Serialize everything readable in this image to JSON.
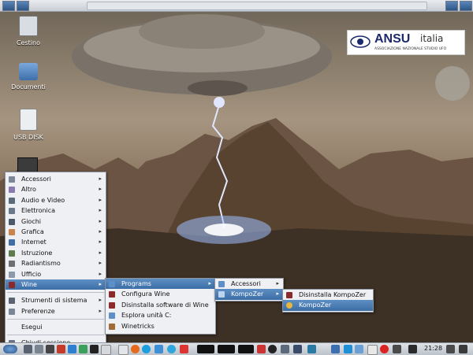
{
  "logo": {
    "brand": "ANSU",
    "suffix": "italia",
    "tagline": "ASSOCIAZIONE NAZIONALE STUDIO UFO"
  },
  "desktop_icons": [
    {
      "label": "Cestino",
      "icon": "trash-icon"
    },
    {
      "label": "Documenti",
      "icon": "folder-icon"
    },
    {
      "label": "USB DISK",
      "icon": "usb-drive-icon"
    }
  ],
  "main_menu": {
    "items": [
      {
        "label": "Accessori",
        "icon": "accessories-icon",
        "submenu": true
      },
      {
        "label": "Altro",
        "icon": "other-icon",
        "submenu": true
      },
      {
        "label": "Audio e Video",
        "icon": "multimedia-icon",
        "submenu": true
      },
      {
        "label": "Elettronica",
        "icon": "electronics-icon",
        "submenu": true
      },
      {
        "label": "Giochi",
        "icon": "games-icon",
        "submenu": true
      },
      {
        "label": "Grafica",
        "icon": "graphics-icon",
        "submenu": true
      },
      {
        "label": "Internet",
        "icon": "internet-icon",
        "submenu": true
      },
      {
        "label": "Istruzione",
        "icon": "education-icon",
        "submenu": true
      },
      {
        "label": "Radiantismo",
        "icon": "ham-radio-icon",
        "submenu": true
      },
      {
        "label": "Ufficio",
        "icon": "office-icon",
        "submenu": true
      },
      {
        "label": "Wine",
        "icon": "wine-icon",
        "submenu": true,
        "highlighted": true
      }
    ],
    "system_items": [
      {
        "label": "Strumenti di sistema",
        "icon": "system-tools-icon",
        "submenu": true
      },
      {
        "label": "Preferenze",
        "icon": "preferences-icon",
        "submenu": true
      }
    ],
    "run_label": "Esegui",
    "logout_label": "Chiudi sessione"
  },
  "wine_menu": {
    "items": [
      {
        "label": "Programs",
        "icon": "folder-icon",
        "submenu": true,
        "highlighted": true
      },
      {
        "label": "Configura Wine",
        "icon": "wine-icon"
      },
      {
        "label": "Disinstalla software di Wine",
        "icon": "wine-icon"
      },
      {
        "label": "Esplora unità C:",
        "icon": "folder-icon"
      },
      {
        "label": "Winetricks",
        "icon": "winetricks-icon"
      }
    ]
  },
  "programs_menu": {
    "items": [
      {
        "label": "Accessori",
        "icon": "folder-icon",
        "submenu": true
      },
      {
        "label": "KompoZer",
        "icon": "folder-icon",
        "submenu": true,
        "highlighted": true
      }
    ]
  },
  "kompozer_menu": {
    "items": [
      {
        "label": "Disinstalla KompoZer",
        "icon": "wine-icon"
      },
      {
        "label": "KompoZer",
        "icon": "kompozer-icon",
        "highlighted": true
      }
    ]
  },
  "taskbar": {
    "clock": "21:28"
  },
  "colors": {
    "highlight": "#4a7db5",
    "menu_bg": "#eef0f3",
    "panel": "#d0d5dc"
  }
}
